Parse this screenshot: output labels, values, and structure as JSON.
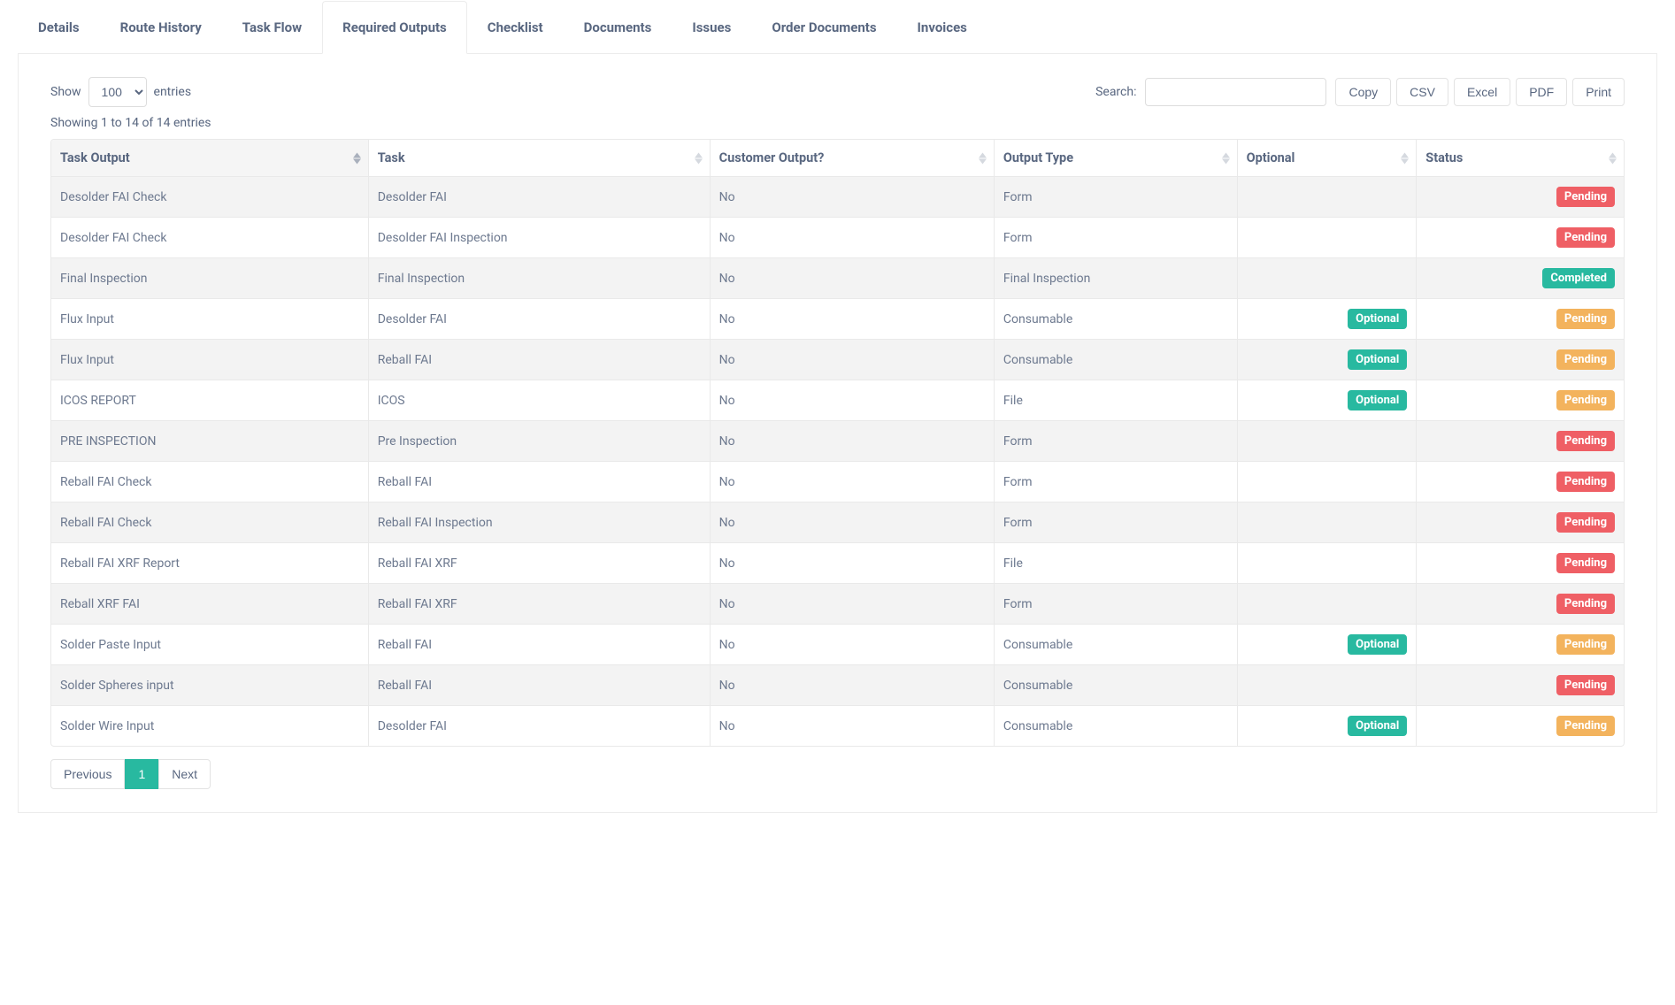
{
  "tabs": [
    {
      "label": "Details",
      "active": false
    },
    {
      "label": "Route History",
      "active": false
    },
    {
      "label": "Task Flow",
      "active": false
    },
    {
      "label": "Required Outputs",
      "active": true
    },
    {
      "label": "Checklist",
      "active": false
    },
    {
      "label": "Documents",
      "active": false
    },
    {
      "label": "Issues",
      "active": false
    },
    {
      "label": "Order Documents",
      "active": false
    },
    {
      "label": "Invoices",
      "active": false
    }
  ],
  "controls": {
    "show_label_pre": "Show",
    "show_label_post": "entries",
    "entries_value": "100",
    "search_label": "Search:",
    "search_value": "",
    "export_buttons": [
      "Copy",
      "CSV",
      "Excel",
      "PDF",
      "Print"
    ]
  },
  "info": "Showing 1 to 14 of 14 entries",
  "columns": [
    {
      "label": "Task Output",
      "sorted": true
    },
    {
      "label": "Task",
      "sorted": false
    },
    {
      "label": "Customer Output?",
      "sorted": false
    },
    {
      "label": "Output Type",
      "sorted": false
    },
    {
      "label": "Optional",
      "sorted": false
    },
    {
      "label": "Status",
      "sorted": false
    }
  ],
  "optional_badge_label": "Optional",
  "status_styles": {
    "Pending_required": "badge-red",
    "Pending_optional": "badge-orange",
    "Completed": "badge-green"
  },
  "rows": [
    {
      "task_output": "Desolder FAI Check",
      "task": "Desolder FAI",
      "customer_output": "No",
      "output_type": "Form",
      "optional": false,
      "status": "Pending"
    },
    {
      "task_output": "Desolder FAI Check",
      "task": "Desolder FAI Inspection",
      "customer_output": "No",
      "output_type": "Form",
      "optional": false,
      "status": "Pending"
    },
    {
      "task_output": "Final Inspection",
      "task": "Final Inspection",
      "customer_output": "No",
      "output_type": "Final Inspection",
      "optional": false,
      "status": "Completed"
    },
    {
      "task_output": "Flux Input",
      "task": "Desolder FAI",
      "customer_output": "No",
      "output_type": "Consumable",
      "optional": true,
      "status": "Pending"
    },
    {
      "task_output": "Flux Input",
      "task": "Reball FAI",
      "customer_output": "No",
      "output_type": "Consumable",
      "optional": true,
      "status": "Pending"
    },
    {
      "task_output": "ICOS REPORT",
      "task": "ICOS",
      "customer_output": "No",
      "output_type": "File",
      "optional": true,
      "status": "Pending"
    },
    {
      "task_output": "PRE INSPECTION",
      "task": "Pre Inspection",
      "customer_output": "No",
      "output_type": "Form",
      "optional": false,
      "status": "Pending"
    },
    {
      "task_output": "Reball FAI Check",
      "task": "Reball FAI",
      "customer_output": "No",
      "output_type": "Form",
      "optional": false,
      "status": "Pending"
    },
    {
      "task_output": "Reball FAI Check",
      "task": "Reball FAI Inspection",
      "customer_output": "No",
      "output_type": "Form",
      "optional": false,
      "status": "Pending"
    },
    {
      "task_output": "Reball FAI XRF Report",
      "task": "Reball FAI XRF",
      "customer_output": "No",
      "output_type": "File",
      "optional": false,
      "status": "Pending"
    },
    {
      "task_output": "Reball XRF FAI",
      "task": "Reball FAI XRF",
      "customer_output": "No",
      "output_type": "Form",
      "optional": false,
      "status": "Pending"
    },
    {
      "task_output": "Solder Paste Input",
      "task": "Reball FAI",
      "customer_output": "No",
      "output_type": "Consumable",
      "optional": true,
      "status": "Pending"
    },
    {
      "task_output": "Solder Spheres input",
      "task": "Reball FAI",
      "customer_output": "No",
      "output_type": "Consumable",
      "optional": false,
      "status": "Pending"
    },
    {
      "task_output": "Solder Wire Input",
      "task": "Desolder FAI",
      "customer_output": "No",
      "output_type": "Consumable",
      "optional": true,
      "status": "Pending"
    }
  ],
  "pagination": {
    "prev": "Previous",
    "next": "Next",
    "pages": [
      "1"
    ],
    "active": "1"
  }
}
